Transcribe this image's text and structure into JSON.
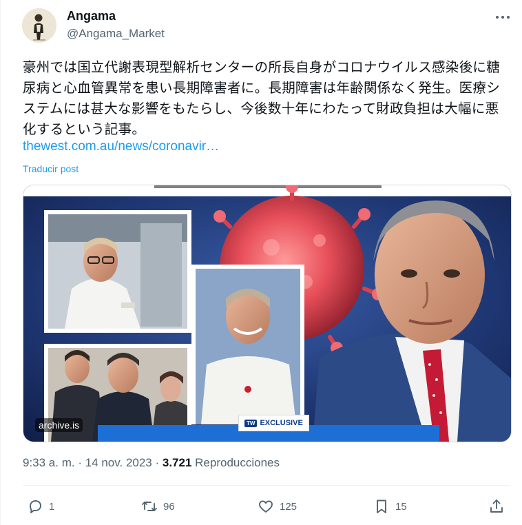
{
  "author": {
    "display_name": "Angama",
    "handle": "@Angama_Market",
    "avatar_icon": "person-sketch-avatar"
  },
  "more_icon": "more-horizontal-icon",
  "tweet": {
    "text": "豪州では国立代謝表現型解析センターの所長自身がコロナウイルス感染後に糖尿病と心血管異常を患い長期障害者に。長期障害は年齢関係なく発生。医療システムには甚大な影響をもたらし、今後数十年にわたって財政負担は大幅に悪化するという記事。",
    "link_text": "thewest.com.au/news/coronavir…",
    "translate_label": "Traducir post"
  },
  "media": {
    "source_label": "archive.is",
    "badge_text": "EXCLUSIVE",
    "badge_mark": "TW"
  },
  "meta": {
    "time": "9:33 a. m.",
    "separator": " · ",
    "date": "14 nov. 2023",
    "views_count": "3.721",
    "views_label": "Reproducciones"
  },
  "actions": {
    "reply_count": "1",
    "repost_count": "96",
    "like_count": "125",
    "bookmark_count": "15"
  },
  "colors": {
    "link": "#1d9bf0",
    "secondary": "#536471",
    "primary_text": "#0f1419",
    "media_banner": "#1d6fd6"
  }
}
